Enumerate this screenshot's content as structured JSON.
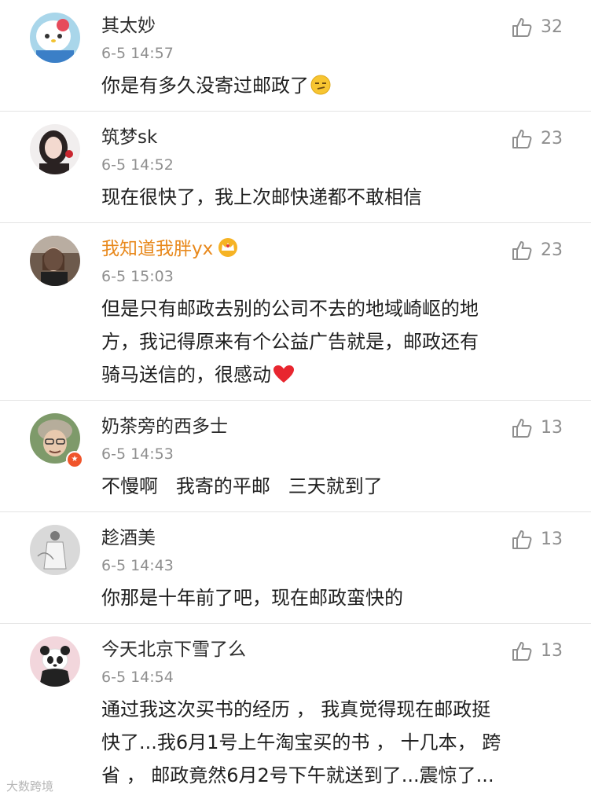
{
  "comments": [
    {
      "username": "其太妙",
      "time": "6-5 14:57",
      "likes": "32",
      "text": "你是有多久没寄过邮政了"
    },
    {
      "username": "筑梦sk",
      "time": "6-5 14:52",
      "likes": "23",
      "text": "现在很快了，我上次邮快递都不敢相信"
    },
    {
      "username": "我知道我胖yx",
      "time": "6-5 15:03",
      "likes": "23",
      "text": "但是只有邮政去别的公司不去的地域崎岖的地\n方，我记得原来有个公益广告就是，邮政还有\n骑马送信的，很感动"
    },
    {
      "username": "奶茶旁的西多士",
      "time": "6-5 14:53",
      "likes": "13",
      "text": "不慢啊   我寄的平邮   三天就到了"
    },
    {
      "username": "趁酒美",
      "time": "6-5 14:43",
      "likes": "13",
      "text": "你那是十年前了吧，现在邮政蛮快的"
    },
    {
      "username": "今天北京下雪了么",
      "time": "6-5 14:54",
      "likes": "13",
      "text": "通过我这次买书的经历 ， 我真觉得现在邮政挺\n快了...我6月1号上午淘宝买的书 ， 十几本， 跨\n省 ， 邮政竟然6月2号下午就送到了...震惊了..."
    }
  ],
  "watermark": "大数跨境",
  "colors": {
    "vip_name": "#e8891d",
    "meta_gray": "#8f8f8f",
    "divider": "#e4e4e4",
    "heart": "#e8262f"
  },
  "icons": {
    "like": "thumbs-up-icon",
    "vip": "crown-icon",
    "heart": "heart-icon",
    "emoji": "smirk-face-icon"
  }
}
